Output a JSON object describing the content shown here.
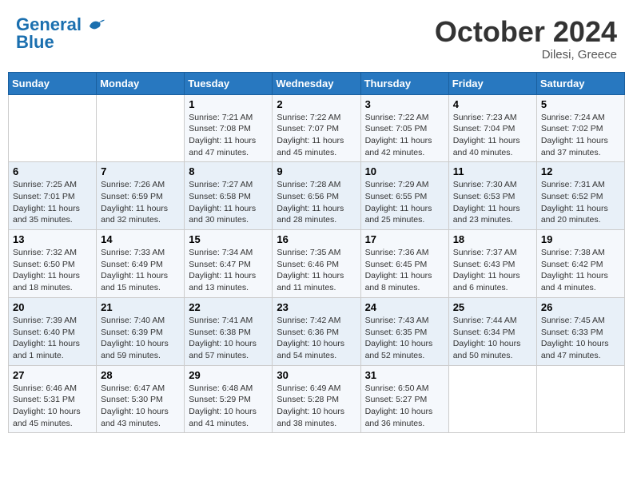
{
  "header": {
    "logo_line1": "General",
    "logo_line2": "Blue",
    "month_title": "October 2024",
    "subtitle": "Dilesi, Greece"
  },
  "days_of_week": [
    "Sunday",
    "Monday",
    "Tuesday",
    "Wednesday",
    "Thursday",
    "Friday",
    "Saturday"
  ],
  "weeks": [
    [
      {
        "day": "",
        "info": ""
      },
      {
        "day": "",
        "info": ""
      },
      {
        "day": "1",
        "info": "Sunrise: 7:21 AM\nSunset: 7:08 PM\nDaylight: 11 hours and 47 minutes."
      },
      {
        "day": "2",
        "info": "Sunrise: 7:22 AM\nSunset: 7:07 PM\nDaylight: 11 hours and 45 minutes."
      },
      {
        "day": "3",
        "info": "Sunrise: 7:22 AM\nSunset: 7:05 PM\nDaylight: 11 hours and 42 minutes."
      },
      {
        "day": "4",
        "info": "Sunrise: 7:23 AM\nSunset: 7:04 PM\nDaylight: 11 hours and 40 minutes."
      },
      {
        "day": "5",
        "info": "Sunrise: 7:24 AM\nSunset: 7:02 PM\nDaylight: 11 hours and 37 minutes."
      }
    ],
    [
      {
        "day": "6",
        "info": "Sunrise: 7:25 AM\nSunset: 7:01 PM\nDaylight: 11 hours and 35 minutes."
      },
      {
        "day": "7",
        "info": "Sunrise: 7:26 AM\nSunset: 6:59 PM\nDaylight: 11 hours and 32 minutes."
      },
      {
        "day": "8",
        "info": "Sunrise: 7:27 AM\nSunset: 6:58 PM\nDaylight: 11 hours and 30 minutes."
      },
      {
        "day": "9",
        "info": "Sunrise: 7:28 AM\nSunset: 6:56 PM\nDaylight: 11 hours and 28 minutes."
      },
      {
        "day": "10",
        "info": "Sunrise: 7:29 AM\nSunset: 6:55 PM\nDaylight: 11 hours and 25 minutes."
      },
      {
        "day": "11",
        "info": "Sunrise: 7:30 AM\nSunset: 6:53 PM\nDaylight: 11 hours and 23 minutes."
      },
      {
        "day": "12",
        "info": "Sunrise: 7:31 AM\nSunset: 6:52 PM\nDaylight: 11 hours and 20 minutes."
      }
    ],
    [
      {
        "day": "13",
        "info": "Sunrise: 7:32 AM\nSunset: 6:50 PM\nDaylight: 11 hours and 18 minutes."
      },
      {
        "day": "14",
        "info": "Sunrise: 7:33 AM\nSunset: 6:49 PM\nDaylight: 11 hours and 15 minutes."
      },
      {
        "day": "15",
        "info": "Sunrise: 7:34 AM\nSunset: 6:47 PM\nDaylight: 11 hours and 13 minutes."
      },
      {
        "day": "16",
        "info": "Sunrise: 7:35 AM\nSunset: 6:46 PM\nDaylight: 11 hours and 11 minutes."
      },
      {
        "day": "17",
        "info": "Sunrise: 7:36 AM\nSunset: 6:45 PM\nDaylight: 11 hours and 8 minutes."
      },
      {
        "day": "18",
        "info": "Sunrise: 7:37 AM\nSunset: 6:43 PM\nDaylight: 11 hours and 6 minutes."
      },
      {
        "day": "19",
        "info": "Sunrise: 7:38 AM\nSunset: 6:42 PM\nDaylight: 11 hours and 4 minutes."
      }
    ],
    [
      {
        "day": "20",
        "info": "Sunrise: 7:39 AM\nSunset: 6:40 PM\nDaylight: 11 hours and 1 minute."
      },
      {
        "day": "21",
        "info": "Sunrise: 7:40 AM\nSunset: 6:39 PM\nDaylight: 10 hours and 59 minutes."
      },
      {
        "day": "22",
        "info": "Sunrise: 7:41 AM\nSunset: 6:38 PM\nDaylight: 10 hours and 57 minutes."
      },
      {
        "day": "23",
        "info": "Sunrise: 7:42 AM\nSunset: 6:36 PM\nDaylight: 10 hours and 54 minutes."
      },
      {
        "day": "24",
        "info": "Sunrise: 7:43 AM\nSunset: 6:35 PM\nDaylight: 10 hours and 52 minutes."
      },
      {
        "day": "25",
        "info": "Sunrise: 7:44 AM\nSunset: 6:34 PM\nDaylight: 10 hours and 50 minutes."
      },
      {
        "day": "26",
        "info": "Sunrise: 7:45 AM\nSunset: 6:33 PM\nDaylight: 10 hours and 47 minutes."
      }
    ],
    [
      {
        "day": "27",
        "info": "Sunrise: 6:46 AM\nSunset: 5:31 PM\nDaylight: 10 hours and 45 minutes."
      },
      {
        "day": "28",
        "info": "Sunrise: 6:47 AM\nSunset: 5:30 PM\nDaylight: 10 hours and 43 minutes."
      },
      {
        "day": "29",
        "info": "Sunrise: 6:48 AM\nSunset: 5:29 PM\nDaylight: 10 hours and 41 minutes."
      },
      {
        "day": "30",
        "info": "Sunrise: 6:49 AM\nSunset: 5:28 PM\nDaylight: 10 hours and 38 minutes."
      },
      {
        "day": "31",
        "info": "Sunrise: 6:50 AM\nSunset: 5:27 PM\nDaylight: 10 hours and 36 minutes."
      },
      {
        "day": "",
        "info": ""
      },
      {
        "day": "",
        "info": ""
      }
    ]
  ]
}
